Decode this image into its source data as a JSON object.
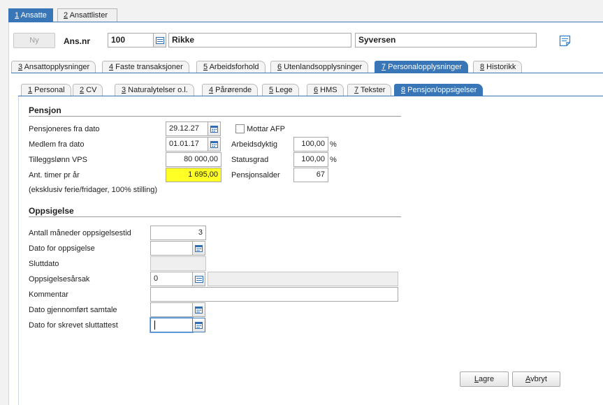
{
  "top_tabs": [
    {
      "key": "1",
      "label": " Ansatte",
      "active": true
    },
    {
      "key": "2",
      "label": " Ansattlister",
      "active": false
    }
  ],
  "header": {
    "new_button": "Ny",
    "ans_nr_label": "Ans.nr",
    "ans_nr_value": "100",
    "first_name": "Rikke",
    "last_name": "Syversen"
  },
  "tabs_row1": [
    {
      "key": "3",
      "label": " Ansattopplysninger"
    },
    {
      "key": "4",
      "label": " Faste transaksjoner"
    },
    {
      "key": "5",
      "label": " Arbeidsforhold"
    },
    {
      "key": "6",
      "label": " Utenlandsopplysninger"
    },
    {
      "key": "7",
      "label": " Personalopplysninger",
      "active": true
    },
    {
      "key": "8",
      "label": " Historikk"
    }
  ],
  "tabs_row2": [
    {
      "key": "1",
      "label": " Personal"
    },
    {
      "key": "2",
      "label": " CV"
    },
    {
      "key": "3",
      "label": " Naturalytelser o.l."
    },
    {
      "key": "4",
      "label": " Pårørende"
    },
    {
      "key": "5",
      "label": " Lege"
    },
    {
      "key": "6",
      "label": " HMS"
    },
    {
      "key": "7",
      "label": " Tekster"
    },
    {
      "key": "8",
      "label": " Pensjon/oppsigelser",
      "active": true
    }
  ],
  "pensjon": {
    "title": "Pensjon",
    "fra_dato_label": "Pensjoneres fra dato",
    "fra_dato_value": "29.12.27",
    "mottar_afp_label": "Mottar AFP",
    "medlem_label": "Medlem fra dato",
    "medlem_value": "01.01.17",
    "arbeidsdyktig_label": "Arbeidsdyktig",
    "arbeidsdyktig_value": "100,00",
    "tilleggslonn_label": "Tilleggslønn VPS",
    "tilleggslonn_value": "80 000,00",
    "statusgrad_label": "Statusgrad",
    "statusgrad_value": "100,00",
    "percent": "%",
    "timer_label": "Ant. timer pr år",
    "timer_value": "1 695,00",
    "pensjonsalder_label": "Pensjonsalder",
    "pensjonsalder_value": "67",
    "note": "(eksklusiv ferie/fridager, 100% stilling)"
  },
  "oppsigelse": {
    "title": "Oppsigelse",
    "maaneder_label": "Antall måneder oppsigelsestid",
    "maaneder_value": "3",
    "dato_label": "Dato for oppsigelse",
    "sluttdato_label": "Sluttdato",
    "aarsak_label": "Oppsigelsesårsak",
    "aarsak_value": "0",
    "kommentar_label": "Kommentar",
    "samtale_label": "Dato gjennomført samtale",
    "sluttattest_label": "Dato for skrevet sluttattest"
  },
  "footer": {
    "save_key": "L",
    "save_rest": "agre",
    "cancel_key": "A",
    "cancel_rest": "vbryt"
  },
  "colors": {
    "accent": "#3876b8",
    "highlight": "#ffff26"
  }
}
